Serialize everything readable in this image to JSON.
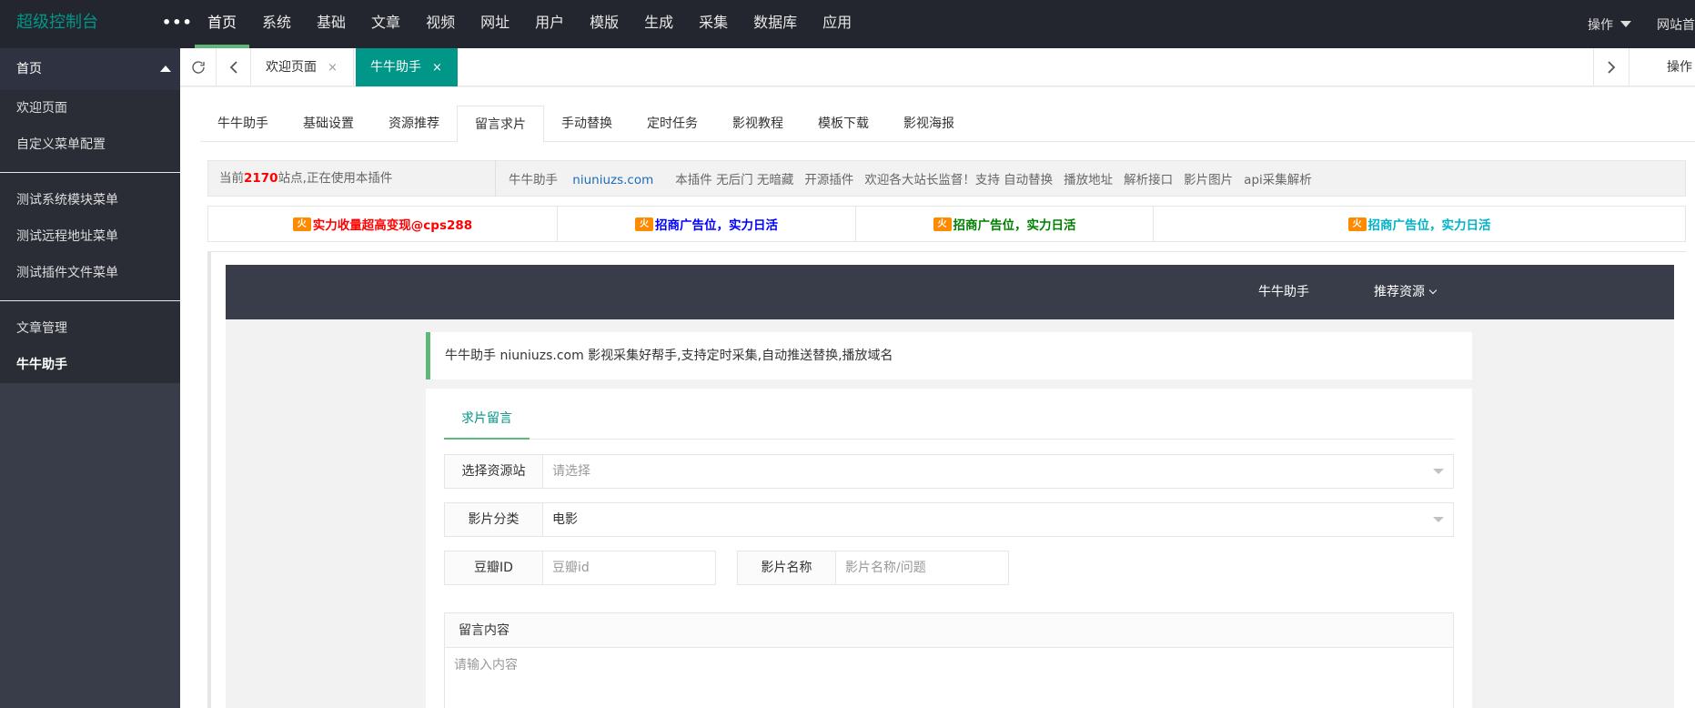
{
  "app": {
    "logo": "超级控制台",
    "dots": "•••",
    "top_nav": [
      "首页",
      "系统",
      "基础",
      "文章",
      "视频",
      "网址",
      "用户",
      "模版",
      "生成",
      "采集",
      "数据库",
      "应用"
    ],
    "top_right": {
      "operate": "操作",
      "site": "网站首页"
    }
  },
  "sidebar": {
    "head": "首页",
    "group1": [
      "欢迎页面",
      "自定义菜单配置"
    ],
    "group2": [
      "测试系统模块菜单",
      "测试远程地址菜单",
      "测试插件文件菜单"
    ],
    "group3": [
      "文章管理",
      "牛牛助手"
    ]
  },
  "tabbar": {
    "tabs": [
      {
        "label": "欢迎页面",
        "close": "×"
      },
      {
        "label": "牛牛助手",
        "close": "×"
      }
    ],
    "operate": "操作"
  },
  "subtabs": [
    "牛牛助手",
    "基础设置",
    "资源推荐",
    "留言求片",
    "手动替换",
    "定时任务",
    "影视教程",
    "模板下载",
    "影视海报"
  ],
  "info": {
    "prefix": "当前",
    "count": "2170",
    "suffix": "站点,正在使用本插件",
    "items": [
      "牛牛助手",
      "niuniuzs.com",
      "本插件 无后门 无暗藏",
      "开源插件",
      "欢迎各大站长监督！支持 自动替换",
      "播放地址",
      "解析接口",
      "影片图片",
      "api采集解析"
    ]
  },
  "ads": [
    {
      "fire": "火",
      "text": "实力收量超高变现@cps288",
      "color": "#ff0000"
    },
    {
      "fire": "火",
      "text": "招商广告位，实力日活",
      "color": "#0000ff"
    },
    {
      "fire": "火",
      "text": "招商广告位，实力日活",
      "color": "#008000"
    },
    {
      "fire": "火",
      "text": "招商广告位，实力日活",
      "color": "#00b3c6"
    }
  ],
  "inner": {
    "nav": [
      "牛牛助手",
      "推荐资源"
    ],
    "notice": "牛牛助手 niuniuzs.com 影视采集好帮手,支持定时采集,自动推送替换,播放域名",
    "card_tab": "求片留言",
    "form": {
      "source_label": "选择资源站",
      "source_placeholder": "请选择",
      "category_label": "影片分类",
      "category_value": "电影",
      "douban_label": "豆瓣ID",
      "douban_placeholder": "豆瓣id",
      "name_label": "影片名称",
      "name_placeholder": "影片名称/问题",
      "message_label": "留言内容",
      "message_placeholder": "请输入内容"
    }
  }
}
